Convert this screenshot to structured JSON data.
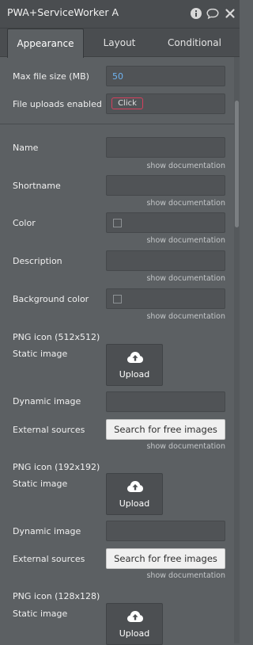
{
  "header": {
    "title": "PWA+ServiceWorker A"
  },
  "tabs": [
    "Appearance",
    "Layout",
    "Conditional"
  ],
  "fields": {
    "max_file_size": {
      "label": "Max file size (MB)",
      "value": "50"
    },
    "file_uploads": {
      "label": "File uploads enabled",
      "button": "Click"
    },
    "name": {
      "label": "Name",
      "value": ""
    },
    "shortname": {
      "label": "Shortname",
      "value": ""
    },
    "color": {
      "label": "Color",
      "checked": false
    },
    "description": {
      "label": "Description",
      "value": ""
    },
    "background_color": {
      "label": "Background color",
      "checked": false
    }
  },
  "doc_link": "show documentation",
  "icons": [
    {
      "section": "PNG icon (512x512)",
      "static_label": "Static image",
      "upload": "Upload",
      "dynamic_label": "Dynamic image",
      "external_label": "External sources",
      "search_button": "Search for free images"
    },
    {
      "section": "PNG icon (192x192)",
      "static_label": "Static image",
      "upload": "Upload",
      "dynamic_label": "Dynamic image",
      "external_label": "External sources",
      "search_button": "Search for free images"
    },
    {
      "section": "PNG icon (128x128)",
      "static_label": "Static image",
      "upload": "Upload"
    }
  ],
  "colors": {
    "accent_value": "#6fb3f0",
    "click_border": "#d6405d"
  }
}
